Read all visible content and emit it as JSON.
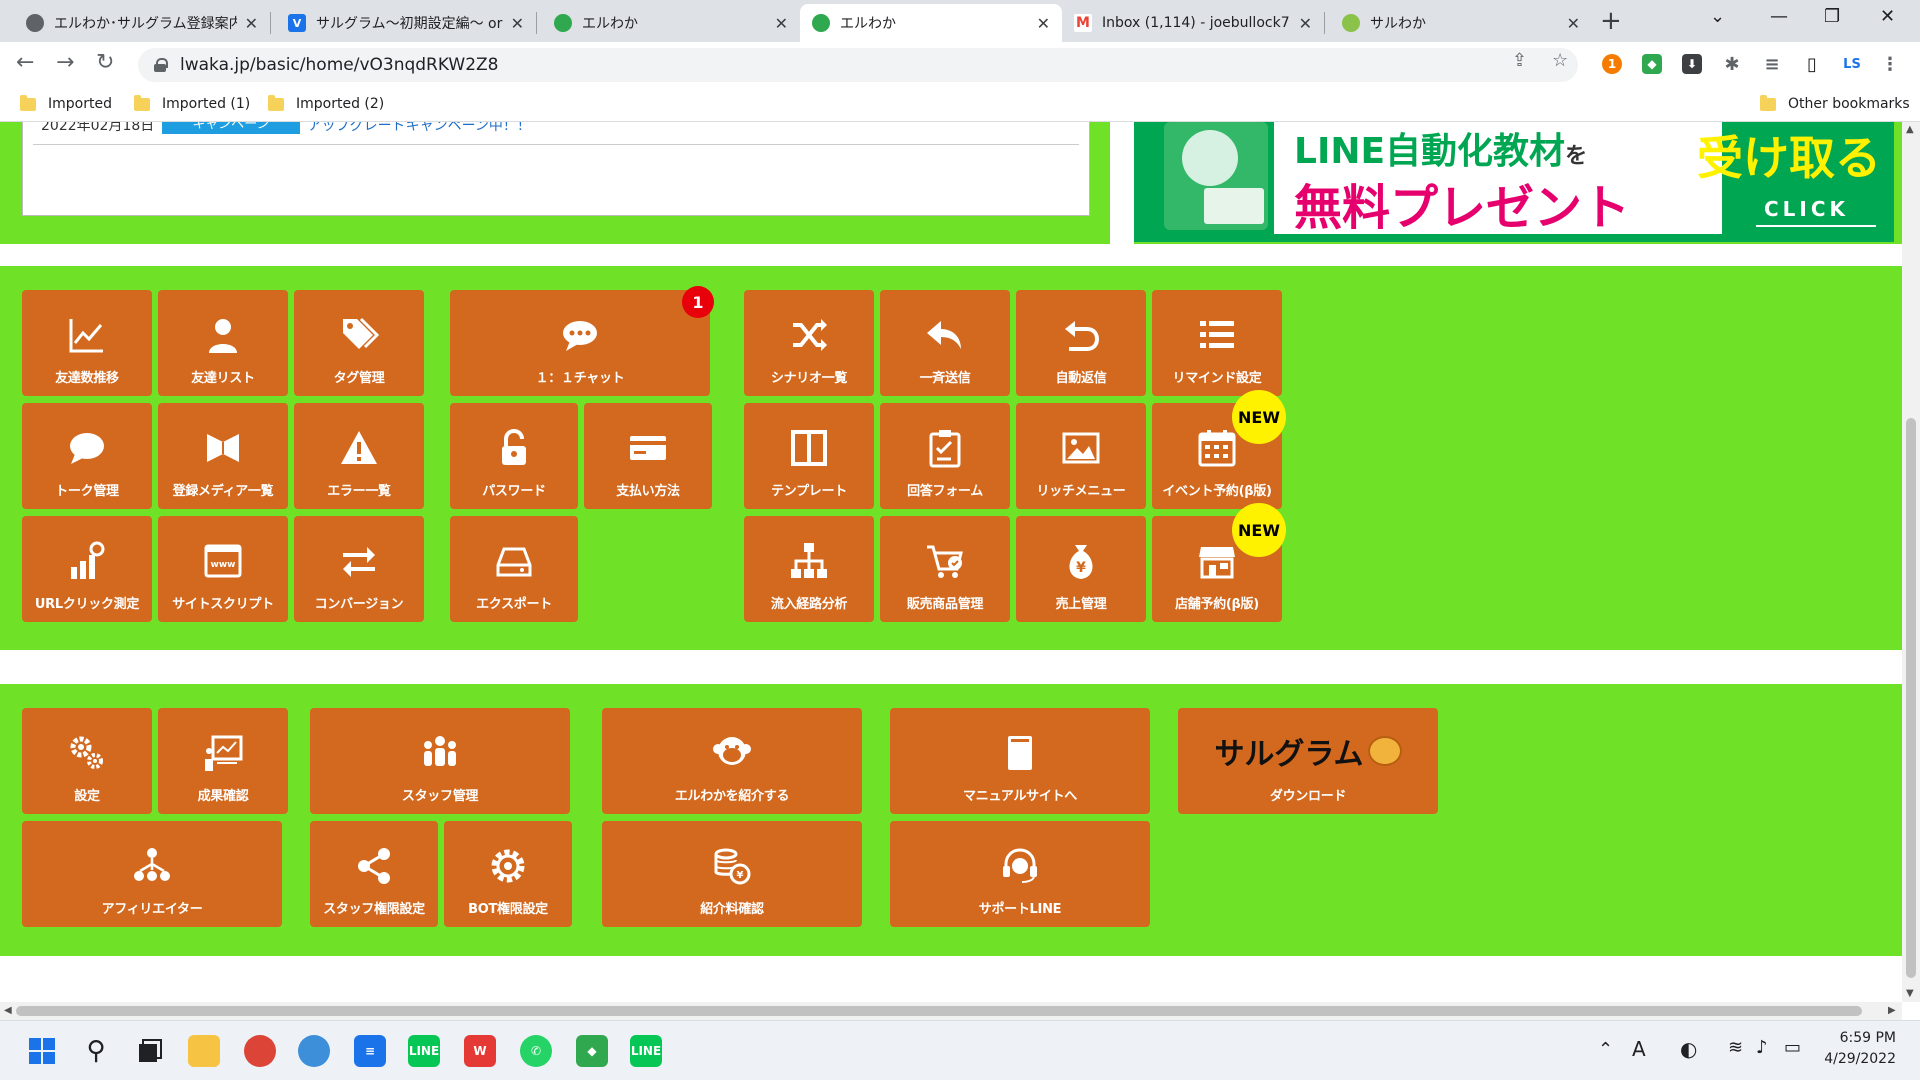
{
  "browser": {
    "tabs": [
      {
        "title": "エルわか･サルグラム登録案内 | ",
        "favicon_color": "#5f6368",
        "active": false
      },
      {
        "title": "サルグラム〜初期設定編〜 or",
        "favicon_color": "#1a73e8",
        "favicon_letter": "V",
        "active": false
      },
      {
        "title": "エルわか",
        "favicon_color": "#2fa84f",
        "active": false
      },
      {
        "title": "エルわか",
        "favicon_color": "#2fa84f",
        "active": true
      },
      {
        "title": "Inbox (1,114) - joebullock7",
        "favicon_color": "#ea4335",
        "favicon_letter": "M",
        "active": false
      },
      {
        "title": "サルわか",
        "favicon_color": "#8bc34a",
        "active": false
      }
    ],
    "url": "lwaka.jp/basic/home/vO3nqdRKW2Z8",
    "bookmarks": [
      "Imported",
      "Imported (1)",
      "Imported (2)"
    ],
    "other_bookmarks": "Other bookmarks",
    "profile_initials": "LS",
    "extension_badge": "1"
  },
  "news": {
    "date": "2022年02月18日",
    "badge": "キャンペーン",
    "link": "アップグレードキャンペーン中！！"
  },
  "banner": {
    "line1": "LINE自動化教材",
    "line1_suffix": "を",
    "line2": "無料プレゼント",
    "line3": "受け取る",
    "click": "CLICK"
  },
  "menu_top": [
    {
      "label": "友達数推移",
      "icon": "chart-line-icon"
    },
    {
      "label": "友達リスト",
      "icon": "user-icon"
    },
    {
      "label": "タグ管理",
      "icon": "tags-icon"
    },
    {
      "label": "１：１チャット",
      "icon": "chat-bubble-icon",
      "badge": "1"
    },
    {
      "label": "シナリオ一覧",
      "icon": "shuffle-icon"
    },
    {
      "label": "一斉送信",
      "icon": "reply-icon"
    },
    {
      "label": "自動返信",
      "icon": "undo-icon"
    },
    {
      "label": "リマインド設定",
      "icon": "list-icon"
    },
    {
      "label": "トーク管理",
      "icon": "comment-icon"
    },
    {
      "label": "登録メディア一覧",
      "icon": "media-icon"
    },
    {
      "label": "エラー一覧",
      "icon": "warning-icon"
    },
    {
      "label": "パスワード",
      "icon": "unlock-icon"
    },
    {
      "label": "支払い方法",
      "icon": "credit-card-icon"
    },
    {
      "label": "テンプレート",
      "icon": "columns-icon"
    },
    {
      "label": "回答フォーム",
      "icon": "clipboard-icon"
    },
    {
      "label": "リッチメニュー",
      "icon": "image-icon"
    },
    {
      "label": "イベント予約(β版)",
      "icon": "calendar-icon",
      "new": "NEW"
    },
    {
      "label": "URLクリック測定",
      "icon": "click-stats-icon"
    },
    {
      "label": "サイトスクリプト",
      "icon": "www-icon"
    },
    {
      "label": "コンバージョン",
      "icon": "exchange-icon"
    },
    {
      "label": "エクスポート",
      "icon": "drive-icon"
    },
    {
      "label": "流入経路分析",
      "icon": "sitemap-icon"
    },
    {
      "label": "販売商品管理",
      "icon": "cart-icon"
    },
    {
      "label": "売上管理",
      "icon": "money-bag-icon"
    },
    {
      "label": "店舗予約(β版)",
      "icon": "store-icon",
      "new": "NEW"
    }
  ],
  "menu_bottom": [
    {
      "label": "設定",
      "icon": "gears-icon"
    },
    {
      "label": "成果確認",
      "icon": "presentation-icon"
    },
    {
      "label": "スタッフ管理",
      "icon": "staff-icon"
    },
    {
      "label": "エルわかを紹介する",
      "icon": "monkey-icon"
    },
    {
      "label": "マニュアルサイトへ",
      "icon": "book-icon"
    },
    {
      "label": "ダウンロード",
      "icon": "sarugram-logo",
      "logo_text": "サルグラム"
    },
    {
      "label": "アフィリエイター",
      "icon": "network-icon"
    },
    {
      "label": "スタッフ権限設定",
      "icon": "share-icon"
    },
    {
      "label": "BOT権限設定",
      "icon": "gear-icon"
    },
    {
      "label": "紹介料確認",
      "icon": "coins-icon"
    },
    {
      "label": "サポートLINE",
      "icon": "headset-icon"
    }
  ],
  "taskbar": {
    "time": "6:59 PM",
    "date": "4/29/2022",
    "ime": "A"
  },
  "colors": {
    "accent_green": "#6fe126",
    "tile_orange": "#d2691e",
    "new_badge": "#fff200",
    "count_badge": "#e8000b"
  }
}
